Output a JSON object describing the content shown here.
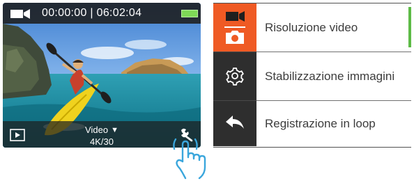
{
  "camera_screen": {
    "timecode": "00:00:00 | 06:02:04",
    "mode_label": "Video",
    "mode_arrow": "▼",
    "resolution": "4K/30",
    "icons": {
      "record": "video-camera-icon",
      "battery": "battery-full-icon",
      "playback": "play-icon",
      "settings": "wrench-icon"
    },
    "colors": {
      "bar": "#1e1e1e",
      "battery": "#7ed957"
    }
  },
  "gesture": {
    "icon": "tap-hand-icon",
    "color": "#3aa6dc"
  },
  "settings_menu": {
    "items": [
      {
        "label": "Risoluzione video",
        "icon": "video-photo-icon",
        "active": true
      },
      {
        "label": "Stabilizzazione immagini",
        "icon": "gear-icon",
        "active": false
      },
      {
        "label": "Registrazione in loop",
        "icon": "back-arrow-icon",
        "active": false
      }
    ],
    "colors": {
      "active_icon_bg": "#ef5a24",
      "icon_bg": "#2e2e2e",
      "scroll_indicator": "#5dbb46"
    }
  }
}
